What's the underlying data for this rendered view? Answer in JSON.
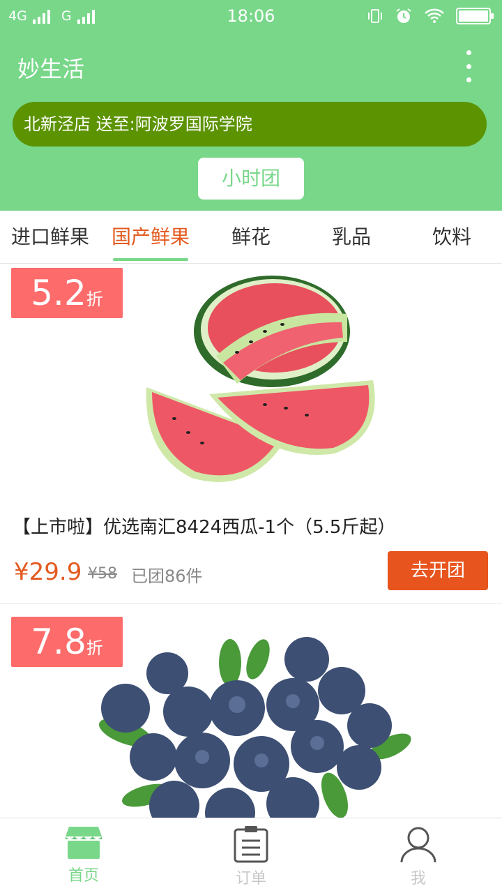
{
  "status_bar": {
    "network": "4G",
    "network2": "G",
    "time": "18:06"
  },
  "header": {
    "title": "妙生活",
    "address": "北新泾店 送至:阿波罗国际学院",
    "group_button": "小时团"
  },
  "tabs": [
    {
      "label": "进口鲜果"
    },
    {
      "label": "国产鲜果",
      "active": true
    },
    {
      "label": "鲜花"
    },
    {
      "label": "乳品"
    },
    {
      "label": "饮料"
    }
  ],
  "products": [
    {
      "discount_value": "5.2",
      "discount_unit": "折",
      "name": "【上市啦】优选南汇8424西瓜-1个（5.5斤起）",
      "price": "¥29.9",
      "old_price": "¥58",
      "sold": "已团86件",
      "button": "去开团",
      "image": "watermelon"
    },
    {
      "discount_value": "7.8",
      "discount_unit": "折",
      "image": "blueberries"
    }
  ],
  "bottom_nav": [
    {
      "label": "首页",
      "icon": "shop-icon",
      "active": true
    },
    {
      "label": "订单",
      "icon": "clipboard-icon"
    },
    {
      "label": "我",
      "icon": "user-icon"
    }
  ],
  "colors": {
    "brand_green": "#79d78a",
    "address_bg": "#5c9300",
    "accent_orange": "#e35a1f",
    "discount_red": "#fd6b6b"
  }
}
